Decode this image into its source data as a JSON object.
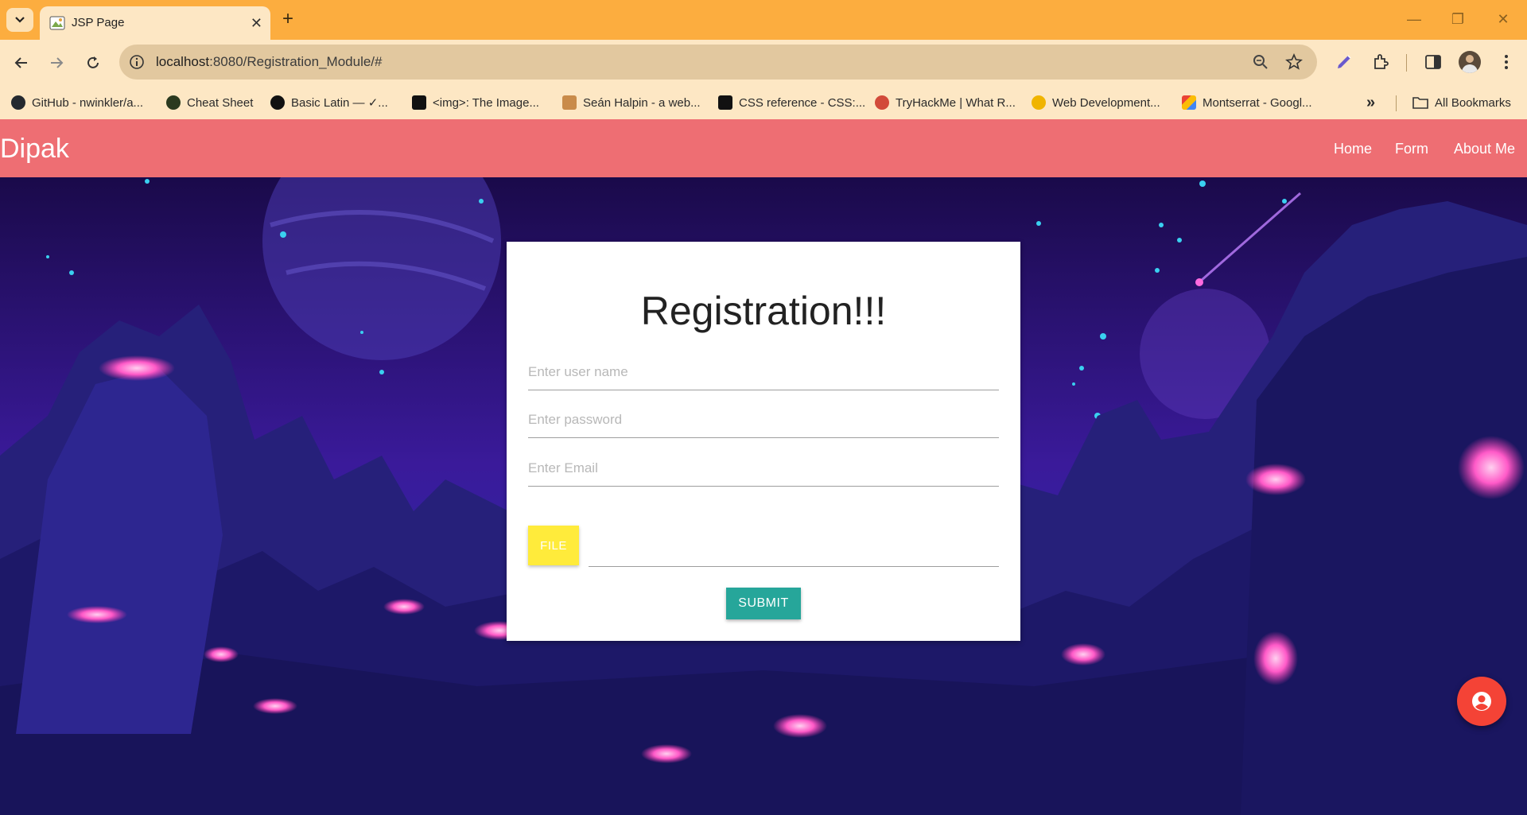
{
  "browser": {
    "tab_title": "JSP Page",
    "url_host": "localhost",
    "url_rest": ":8080/Registration_Module/#",
    "bookmarks": [
      {
        "label": "GitHub - nwinkler/a...",
        "color": "#24292f"
      },
      {
        "label": "Cheat Sheet",
        "color": "#2b3a1f"
      },
      {
        "label": "Basic Latin — ✓...",
        "color": "#111111"
      },
      {
        "label": "<img>: The Image...",
        "color": "#111111"
      },
      {
        "label": "Seán Halpin - a web...",
        "color": "#c98b4a"
      },
      {
        "label": "CSS reference - CSS:...",
        "color": "#111111"
      },
      {
        "label": "TryHackMe | What R...",
        "color": "#d24a3a"
      },
      {
        "label": "Web Development...",
        "color": "#f0b400"
      },
      {
        "label": "Montserrat - Googl...",
        "color": "#4285f4"
      }
    ],
    "all_bookmarks": "All Bookmarks",
    "more_bookmarks": "»"
  },
  "navbar": {
    "brand": "Dipak",
    "links": [
      "Home",
      "Form",
      "About Me"
    ],
    "color": "#ee6e73"
  },
  "form": {
    "title": "Registration!!!",
    "username_placeholder": "Enter user name",
    "password_placeholder": "Enter password",
    "email_placeholder": "Enter Email",
    "file_label": "FILE",
    "submit_label": "SUBMIT",
    "file_color": "#ffeb3b",
    "submit_color": "#26a69a"
  },
  "fab": {
    "icon": "account-circle-icon",
    "color": "#f44336"
  }
}
